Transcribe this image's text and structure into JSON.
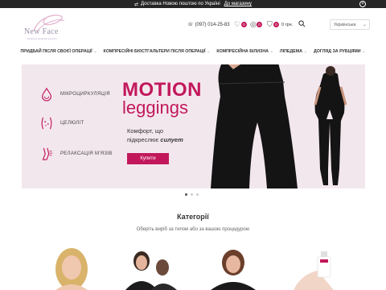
{
  "topbar": {
    "text": "Доставка Новою поштою по Україні",
    "link": "До магазину"
  },
  "brand": {
    "name": "New Face",
    "tagline": "medical & aesthetic services"
  },
  "header": {
    "phone": "(097) 014-25-83",
    "wishlist_count": "0",
    "compare_count": "0",
    "cart_count": "0",
    "cart_total": "0 грн.",
    "language": "Українська"
  },
  "nav": [
    "ПРИДБАЙ ПІСЛЯ СВОЄЇ ОПЕРАЦІЇ",
    "КОМПРЕСІЙНІ БЮСТГАЛЬТЕРИ ПІСЛЯ ОПЕРАЦІЇ",
    "КОМПРЕСІЙНА БІЛИЗНА",
    "ЛІПЕДЕМА",
    "ДОГЛЯД ЗА РУБЦЯМИ"
  ],
  "hero": {
    "features": [
      "МІКРОЦИРКУЛЯЦІЯ",
      "ЦЕЛЮЛІТ",
      "РЕЛАКСАЦІЯ М'ЯЗІВ"
    ],
    "title1": "MOTION",
    "title2": "leggings",
    "text1": "Комфорт, що",
    "text2": "підкреслює",
    "text_bold": "силует",
    "button": "Купити"
  },
  "categories": {
    "title": "Категорії",
    "subtitle": "Оберіть виріб за типом або за вашою процедурою"
  },
  "colors": {
    "accent": "#c2185b",
    "hero_bg": "#f3e7ee",
    "topbar": "#262626"
  }
}
